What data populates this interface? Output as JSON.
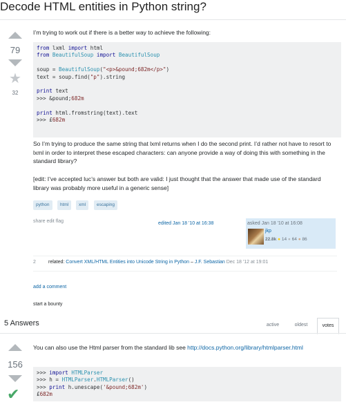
{
  "question": {
    "title": "Decode HTML entities in Python string?",
    "votes": "79",
    "favorites": "32",
    "intro": "I’m trying to work out if there is a better way to achieve the following:",
    "body_p1": "So I’m trying to produce the same string that lxml returns when I do the second print. I’d rather not have to resort to lxml in order to interpret these escaped characters: can anyone provide a way of doing this with something in the standard library?",
    "body_p2": "[edit: I’ve accepted luc’s answer but both are valid: I just thought that the answer that made use of the standard library was probably more useful in a generic sense]",
    "tags": [
      "python",
      "html",
      "xml",
      "escaping"
    ],
    "actions": {
      "share": "share",
      "edit": "edit",
      "flag": "flag"
    },
    "edited": "edited Jan 18 '10 at 16:38",
    "asked": "asked Jan 18 '10 at 16:08",
    "owner": {
      "name": "jkp",
      "rep": "22.8k",
      "gold": "14",
      "silver": "64",
      "bronze": "86"
    },
    "comment": {
      "score": "2",
      "prefix": "related: ",
      "link": "Convert XML/HTML Entities into Unicode String in Python",
      "dash": " – ",
      "author": "J.F. Sebastian",
      "date": "Dec 18 '12 at 19:01"
    },
    "add_comment": "add a comment",
    "bounty": "start a bounty"
  },
  "answers_header": {
    "count": "5 Answers",
    "tabs": [
      "active",
      "oldest",
      "votes"
    ],
    "active_tab": "votes"
  },
  "answer": {
    "votes": "156",
    "text_prefix": "You can also use the Html parser from the standard lib see ",
    "link": "http://docs.python.org/library/htmlparser.html"
  },
  "colors": {
    "link": "#0c65a5",
    "tag_bg": "#e1ecf4",
    "accepted": "#48a868",
    "owner_bg": "#d9eaf7"
  }
}
